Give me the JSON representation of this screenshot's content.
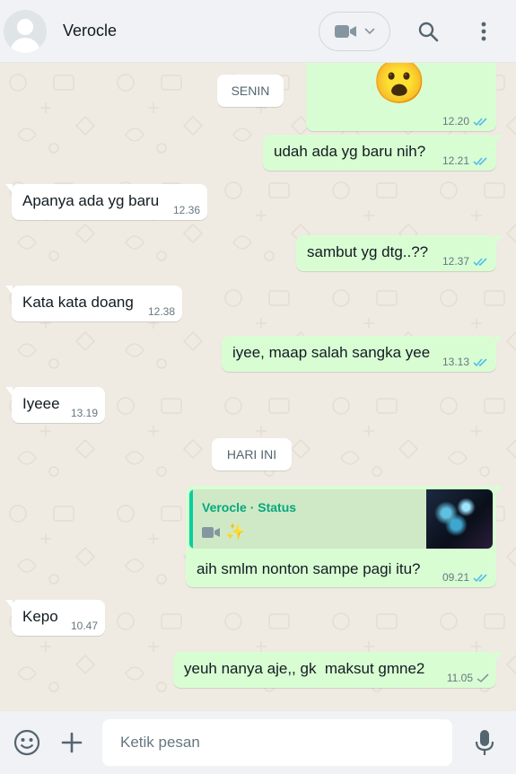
{
  "header": {
    "contact_name": "Verocle",
    "avatar_icon": "default-avatar-icon",
    "video_icon": "video-camera-icon",
    "search_icon": "search-icon",
    "menu_icon": "more-vertical-icon"
  },
  "date_chips": {
    "first": "SENIN",
    "second": "HARI INI"
  },
  "messages": [
    {
      "dir": "out",
      "text": "😮",
      "time": "12.20",
      "status": "read"
    },
    {
      "dir": "out",
      "text": "udah ada yg baru nih?",
      "time": "12.21",
      "status": "read"
    },
    {
      "dir": "in",
      "text": "Apanya ada yg baru",
      "time": "12.36"
    },
    {
      "dir": "out",
      "text": "sambut yg dtg..??",
      "time": "12.37",
      "status": "read"
    },
    {
      "dir": "in",
      "text": "Kata kata doang",
      "time": "12.38"
    },
    {
      "dir": "out",
      "text": "iyee, maap salah sangka yee",
      "time": "13.13",
      "status": "read"
    },
    {
      "dir": "in",
      "text": "Iyeee",
      "time": "13.19"
    },
    {
      "dir": "out",
      "text": "aih smlm nonton sampe pagi itu?",
      "time": "09.21",
      "status": "read",
      "quote": {
        "name": "Verocle · Status",
        "icons": "video-camera-icon sparkles-icon",
        "emoji": "✨"
      }
    },
    {
      "dir": "in",
      "text": "Kepo",
      "time": "10.47"
    },
    {
      "dir": "out",
      "text": "yeuh nanya aje,, gk  maksut gmne2",
      "time": "11.05",
      "status": "sent"
    }
  ],
  "composer": {
    "placeholder": "Ketik pesan",
    "emoji_icon": "smiley-icon",
    "attach_icon": "plus-icon",
    "mic_icon": "microphone-icon"
  },
  "colors": {
    "outgoing_bubble": "#d9fdd3",
    "incoming_bubble": "#ffffff",
    "chat_background": "#efeae2",
    "read_ticks": "#53bdeb",
    "status_accent": "#06cf9c"
  }
}
